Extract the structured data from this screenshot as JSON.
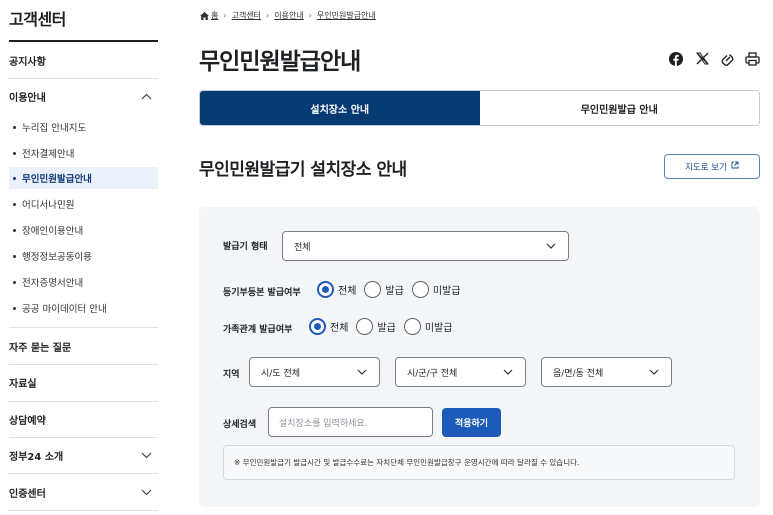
{
  "sidebar": {
    "title": "고객센터",
    "sections": [
      {
        "label": "공지사항"
      },
      {
        "label": "이용안내"
      },
      {
        "label": "자주 묻는 질문"
      },
      {
        "label": "자료실"
      },
      {
        "label": "상담예약"
      },
      {
        "label": "정부24 소개"
      },
      {
        "label": "인증센터"
      }
    ],
    "sub_items": [
      {
        "label": "누리집 안내지도"
      },
      {
        "label": "전자결제안내"
      },
      {
        "label": "무인민원발급안내"
      },
      {
        "label": "어디서나민원"
      },
      {
        "label": "장애인이용안내"
      },
      {
        "label": "행정정보공동이용"
      },
      {
        "label": "전자증명서안내"
      },
      {
        "label": "공공 마이데이터 안내"
      }
    ]
  },
  "breadcrumb": [
    "홈",
    "고객센터",
    "이용안내",
    "무인민원발급안내"
  ],
  "page_title": "무인민원발급안내",
  "share_icons": [
    "facebook-icon",
    "x-icon",
    "link-icon",
    "print-icon"
  ],
  "tabs": [
    {
      "label": "설치장소 안내"
    },
    {
      "label": "무인민원발급 안내"
    }
  ],
  "section_title": "무인민원발급기 설치장소 안내",
  "map_button": "지도로 보기",
  "filters": {
    "type_label": "발급기 형태",
    "type_value": "전체",
    "registry_label": "등기부등본 발급여부",
    "registry_options": [
      "전체",
      "발급",
      "미발급"
    ],
    "family_label": "가족관계 발급여부",
    "family_options": [
      "전체",
      "발급",
      "미발급"
    ],
    "region_label": "지역",
    "sido": "시/도 전체",
    "sigungu": "시/군/구 전체",
    "eupmyeondong": "읍/면/동 전체",
    "search_label": "상세검색",
    "search_placeholder": "설치장소를 입력하세요.",
    "apply": "적용하기"
  },
  "notice": "※ 무인민원발급기 발급시간 및 발급수수료는 자치단체 무인민원발급창구 운영시간에 따라 달라질 수 있습니다.",
  "colors": {
    "primary": "#063a73",
    "accent": "#1d5bb8",
    "panel": "#f3f5f8"
  }
}
